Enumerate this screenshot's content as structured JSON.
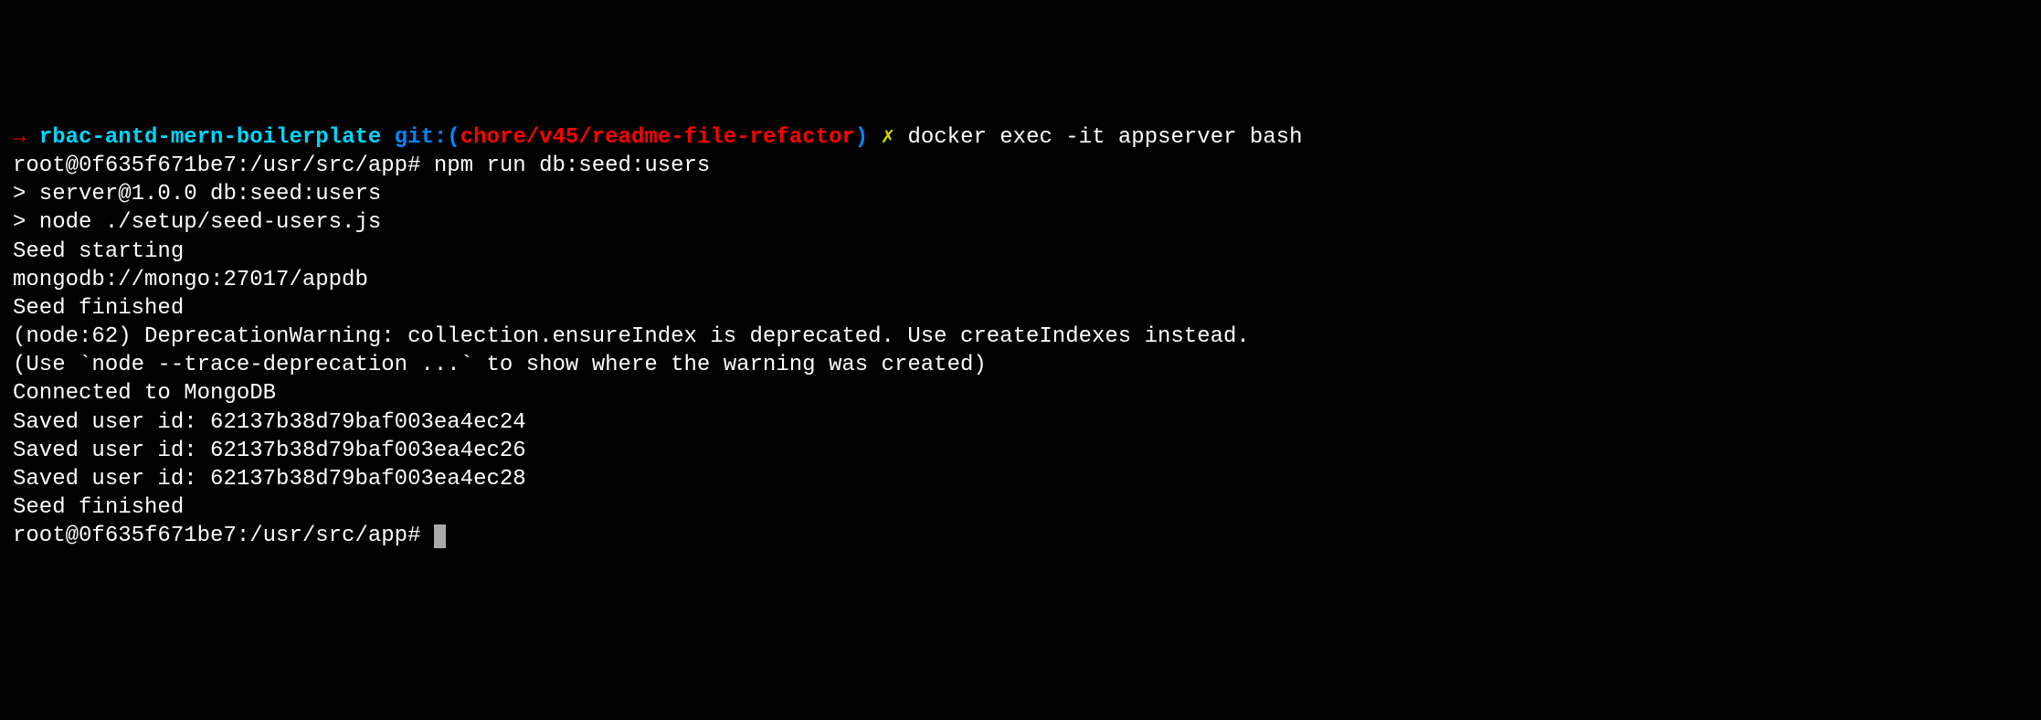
{
  "prompt1": {
    "arrow": "→ ",
    "repo": "rbac-antd-mern-boilerplate",
    "git_label": " git:",
    "paren_open": "(",
    "branch": "chore/v45/readme-file-refactor",
    "paren_close": ")",
    "x_mark": " ✗ ",
    "command": "docker exec -it appserver bash"
  },
  "line2": {
    "prompt": "root@0f635f671be7:/usr/src/app# ",
    "command": "npm run db:seed:users"
  },
  "blank1": "",
  "line4": "> server@1.0.0 db:seed:users",
  "line5": "> node ./setup/seed-users.js",
  "blank2": "",
  "line7": "Seed starting",
  "line8": "mongodb://mongo:27017/appdb",
  "line9": "Seed finished",
  "line10": "(node:62) DeprecationWarning: collection.ensureIndex is deprecated. Use createIndexes instead.",
  "line11": "(Use `node --trace-deprecation ...` to show where the warning was created)",
  "line12": "Connected to MongoDB",
  "line13": "Saved user id: 62137b38d79baf003ea4ec24",
  "line14": "Saved user id: 62137b38d79baf003ea4ec26",
  "line15": "Saved user id: 62137b38d79baf003ea4ec28",
  "line16": "Seed finished",
  "line17": {
    "prompt": "root@0f635f671be7:/usr/src/app# "
  }
}
